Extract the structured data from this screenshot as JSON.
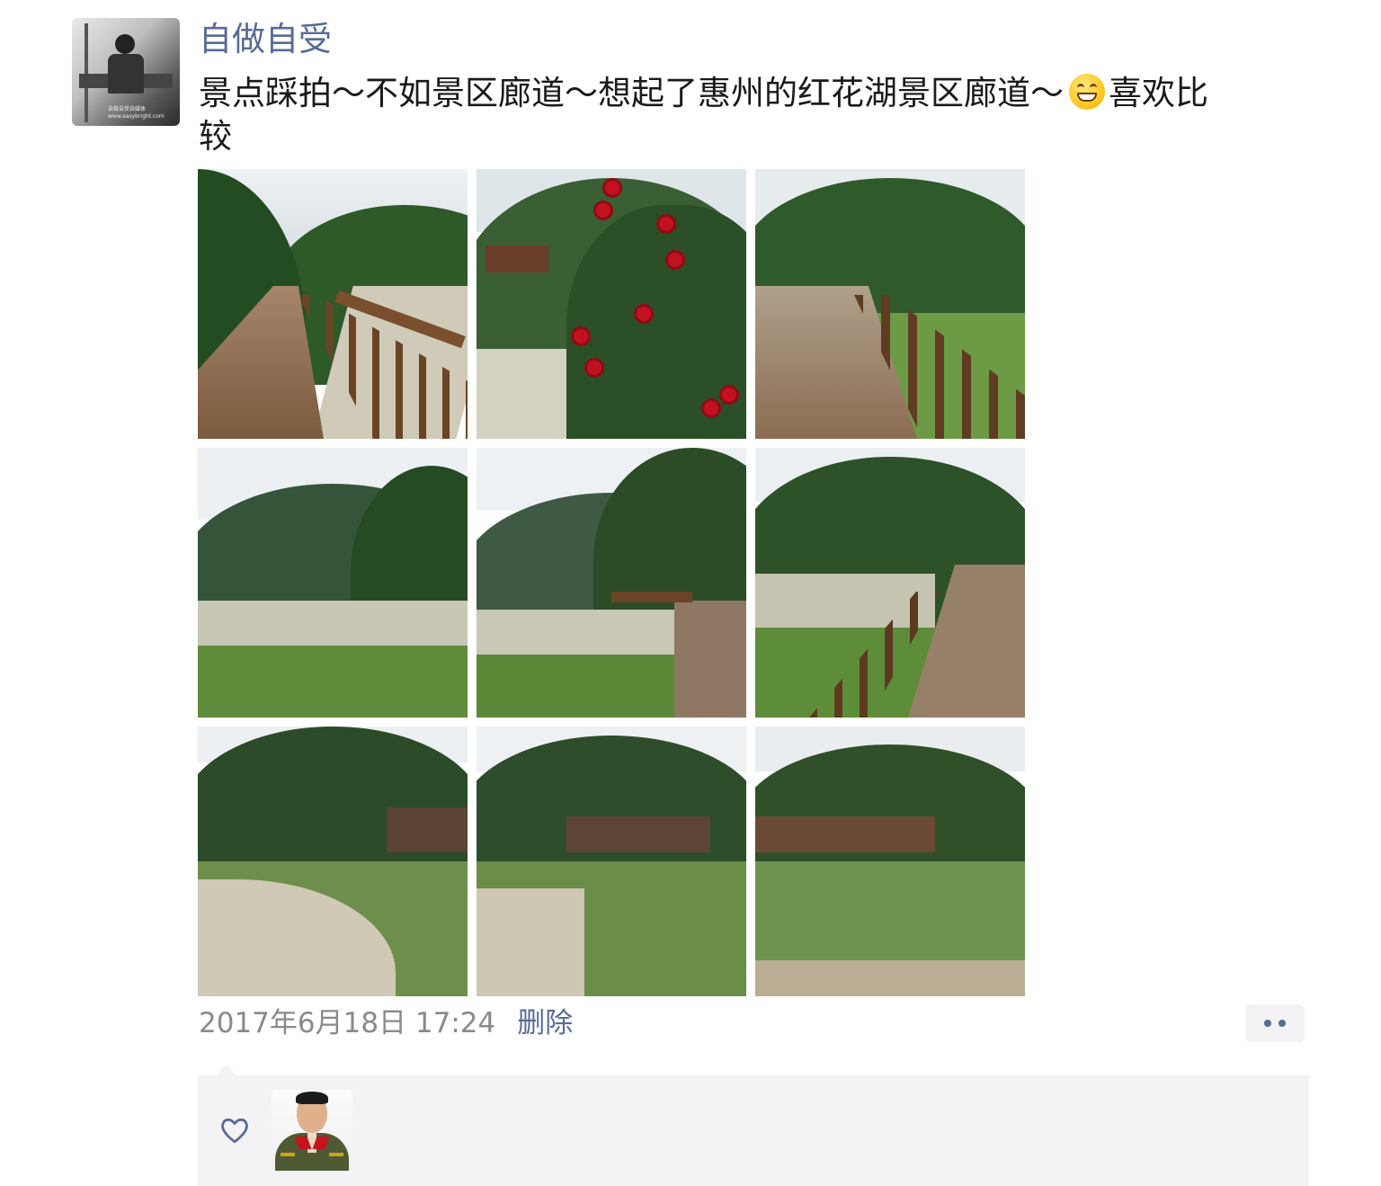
{
  "post": {
    "author": "自做自受",
    "text_line1": "景点踩拍～不如景区廊道～想起了惠州的红花湖景区廊道～",
    "emoji": "grinning-face-emoji",
    "text_line1_end": "喜欢比",
    "text_line2": "较",
    "avatar_caption_1": "自做自受自媒体",
    "avatar_caption_2": "www.easybright.com",
    "photos": [
      {
        "scene": "boardwalk-mountain-river"
      },
      {
        "scene": "red-hollyhock-flowers"
      },
      {
        "scene": "boardwalk-green-field"
      },
      {
        "scene": "mountain-valley-river"
      },
      {
        "scene": "valley-boardwalk-bend"
      },
      {
        "scene": "boardwalk-with-cart"
      },
      {
        "scene": "village-riverbend"
      },
      {
        "scene": "village-riverbend-closer"
      },
      {
        "scene": "village-terraced-garden"
      }
    ],
    "timestamp": "2017年6月18日 17:24",
    "delete_label": "删除",
    "more_icon": "more-dots-icon"
  },
  "likes": {
    "heart_icon": "heart-outline-icon",
    "likers": [
      {
        "avatar": "liker-avatar-military-officer"
      }
    ]
  },
  "colors": {
    "link": "#576b95",
    "timestamp": "#8a8a8a",
    "panel_bg": "#f3f3f5",
    "text": "#1a1a1a"
  }
}
